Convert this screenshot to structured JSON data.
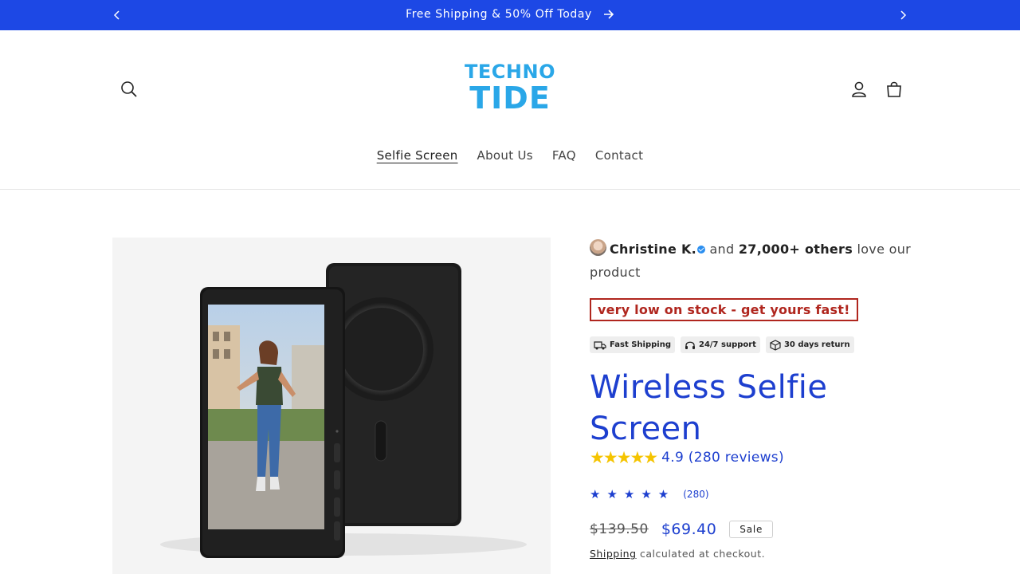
{
  "announcement": {
    "text": "Free Shipping & 50% Off Today",
    "bg_color": "#1d48e5"
  },
  "header": {
    "logo_line1": "TECHNO",
    "logo_line2": "TIDE",
    "logo_color": "#2aa7e8",
    "nav": [
      {
        "label": "Selfie Screen",
        "active": true
      },
      {
        "label": "About Us",
        "active": false
      },
      {
        "label": "FAQ",
        "active": false
      },
      {
        "label": "Contact",
        "active": false
      }
    ]
  },
  "product": {
    "social_proof": {
      "name": "Christine K.",
      "and": "and",
      "count": "27,000+ others",
      "suffix": "love our product"
    },
    "stock_warning": "very low on stock - get yours fast!",
    "badges": [
      {
        "icon": "truck-icon",
        "label": "Fast Shipping"
      },
      {
        "icon": "headset-icon",
        "label": "24/7 support"
      },
      {
        "icon": "box-icon",
        "label": "30 days return"
      }
    ],
    "title": "Wireless Selfie Screen",
    "rating": {
      "stars_display": "★★★★★",
      "text": "4.9 (280 reviews)",
      "value": 4.9,
      "reviews": 280
    },
    "rating_small": {
      "stars_display": "★★★★★",
      "count": "(280)"
    },
    "price_old": "$139.50",
    "price_new": "$69.40",
    "sale_label": "Sale",
    "shipping_link": "Shipping",
    "shipping_suffix": "calculated at checkout.",
    "accent_color": "#1d3fcf"
  }
}
